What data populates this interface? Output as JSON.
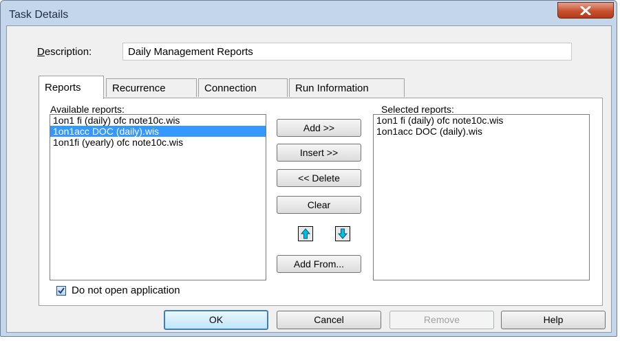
{
  "window": {
    "title": "Task Details"
  },
  "description": {
    "label": "Description:",
    "value": "Daily Management Reports"
  },
  "tabs": [
    {
      "label": "Reports",
      "active": true
    },
    {
      "label": "Recurrence"
    },
    {
      "label": "Connection"
    },
    {
      "label": "Run Information"
    }
  ],
  "available": {
    "label": "Available reports:",
    "items": [
      "1on1 fi (daily) ofc note10c.wis",
      "1on1acc DOC (daily).wis",
      "1on1fi (yearly) ofc note10c.wis"
    ],
    "selected_index": 1
  },
  "selected": {
    "label": "Selected reports:",
    "items": [
      "1on1 fi (daily) ofc note10c.wis",
      "1on1acc DOC (daily).wis"
    ]
  },
  "buttons": {
    "add": "Add >>",
    "insert": "Insert >>",
    "delete": "<< Delete",
    "clear": "Clear",
    "add_from": "Add From...",
    "ok": "OK",
    "cancel": "Cancel",
    "remove": "Remove",
    "help": "Help"
  },
  "checkbox": {
    "label": "Do not open application",
    "checked": true
  },
  "icons": {
    "close": "close-icon",
    "move_up": "arrow-up-icon",
    "move_down": "arrow-down-icon",
    "check": "checkmark-icon"
  },
  "colors": {
    "selection": "#3399ff",
    "arrow": "#00c0e0",
    "close_button": "#c7512f"
  }
}
